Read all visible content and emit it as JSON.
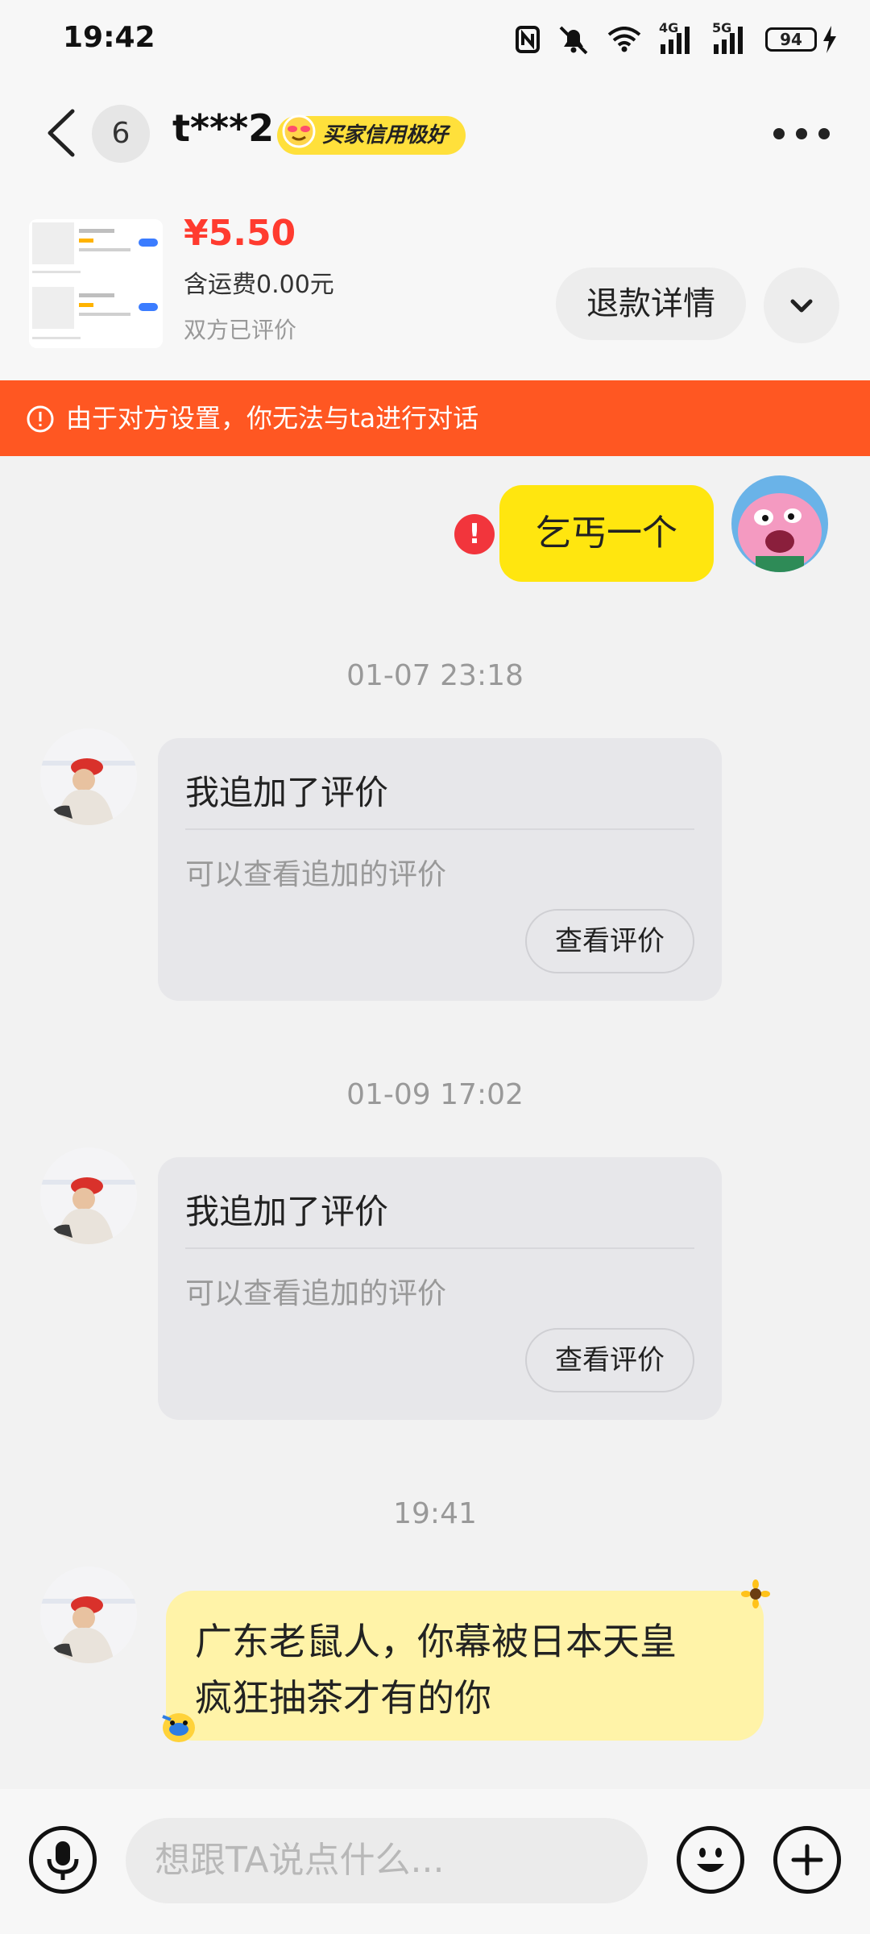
{
  "status_bar": {
    "time": "19:42",
    "battery": "94",
    "network_1": "4G",
    "network_2": "5G"
  },
  "header": {
    "unread_count": "6",
    "contact_name": "t***2",
    "credit_badge": "买家信用极好"
  },
  "product": {
    "price": "¥5.50",
    "shipping": "含运费0.00元",
    "status": "双方已评价",
    "refund_button": "退款详情"
  },
  "banner": {
    "text": "由于对方设置，你无法与ta进行对话"
  },
  "messages": {
    "sent_text": "乞丐一个",
    "timestamp_1": "01-07 23:18",
    "card_1": {
      "title": "我追加了评价",
      "subtitle": "可以查看追加的评价",
      "button": "查看评价"
    },
    "timestamp_2": "01-09 17:02",
    "card_2": {
      "title": "我追加了评价",
      "subtitle": "可以查看追加的评价",
      "button": "查看评价"
    },
    "timestamp_3": "19:41",
    "received_line_1": "广东老鼠人，你幕被日本天皇",
    "received_line_2": "疯狂抽茶才有的你"
  },
  "input": {
    "placeholder": "想跟TA说点什么..."
  },
  "colors": {
    "accent_yellow": "#ffe60f",
    "banner_orange": "#ff5722",
    "price_red": "#ff3b2f"
  }
}
